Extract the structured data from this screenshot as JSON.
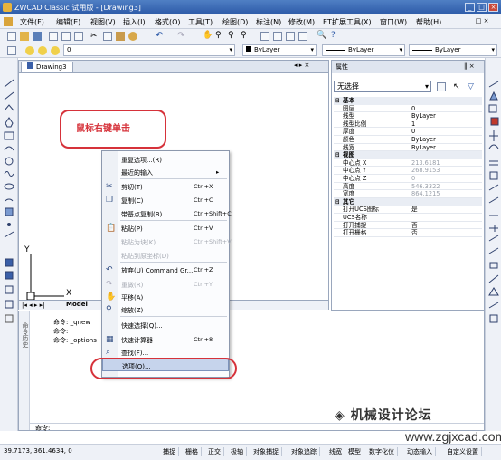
{
  "titlebar": {
    "title": "ZWCAD Classic 试用版 - [Drawing3]"
  },
  "menu": [
    "文件(F)",
    "编辑(E)",
    "视图(V)",
    "插入(I)",
    "格式(O)",
    "工具(T)",
    "绘图(D)",
    "标注(N)",
    "修改(M)",
    "ET扩展工具(X)",
    "窗口(W)",
    "帮助(H)"
  ],
  "toolbar2": {
    "layer": "0",
    "color": "ByLayer",
    "linetype": "ByLayer",
    "lineweight": "ByLayer"
  },
  "drawing": {
    "tab": "Drawing3",
    "model_tab": "Model",
    "axis_x": "X",
    "axis_y": "Y"
  },
  "properties": {
    "title": "属性",
    "selection": "无选择",
    "rows": [
      {
        "k": "基本",
        "v": "",
        "sec": true
      },
      {
        "k": "图层",
        "v": "0"
      },
      {
        "k": "线型",
        "v": "ByLayer"
      },
      {
        "k": "线型比例",
        "v": "1"
      },
      {
        "k": "厚度",
        "v": "0"
      },
      {
        "k": "颜色",
        "v": "ByLayer"
      },
      {
        "k": "线宽",
        "v": "ByLayer"
      },
      {
        "k": "视图",
        "v": "",
        "sec": true
      },
      {
        "k": "中心点 X",
        "v": "213.6181",
        "dim": true
      },
      {
        "k": "中心点 Y",
        "v": "268.9153",
        "dim": true
      },
      {
        "k": "中心点 Z",
        "v": "0",
        "dim": true
      },
      {
        "k": "高度",
        "v": "546.3322",
        "dim": true
      },
      {
        "k": "宽度",
        "v": "864.1215",
        "dim": true
      },
      {
        "k": "其它",
        "v": "",
        "sec": true
      },
      {
        "k": "打开UCS图标",
        "v": "是"
      },
      {
        "k": "UCS名称",
        "v": ""
      },
      {
        "k": "打开捕捉",
        "v": "否"
      },
      {
        "k": "打开栅格",
        "v": "否"
      }
    ]
  },
  "command": {
    "lines": [
      "命令:  _qnew",
      "命令:",
      "命令:  _options"
    ],
    "prompt": "命令:",
    "side_label": "命令历史"
  },
  "context_menu": {
    "items": [
      {
        "label": "重复选项...(R)",
        "shortcut": "",
        "submenu": false
      },
      {
        "label": "最近的输入",
        "shortcut": "▸",
        "submenu": true
      },
      {
        "label": "剪切(T)",
        "shortcut": "Ctrl+X",
        "icon": "scissors-icon"
      },
      {
        "label": "复制(C)",
        "shortcut": "Ctrl+C",
        "icon": "copy-icon"
      },
      {
        "label": "带基点复制(B)",
        "shortcut": "Ctrl+Shift+C"
      },
      {
        "label": "粘贴(P)",
        "shortcut": "Ctrl+V",
        "icon": "paste-icon"
      },
      {
        "label": "粘贴为块(K)",
        "shortcut": "Ctrl+Shift+V",
        "disabled": true
      },
      {
        "label": "粘贴到原坐标(D)",
        "shortcut": "",
        "disabled": true
      },
      {
        "label": "放弃(U) Command Gr...",
        "shortcut": "Ctrl+Z",
        "icon": "undo-icon"
      },
      {
        "label": "重做(R)",
        "shortcut": "Ctrl+Y",
        "disabled": true,
        "icon": "redo-icon"
      },
      {
        "label": "平移(A)",
        "shortcut": "",
        "icon": "pan-hand-icon"
      },
      {
        "label": "缩放(Z)",
        "shortcut": "",
        "icon": "zoom-icon"
      },
      {
        "label": "快速选择(Q)...",
        "shortcut": ""
      },
      {
        "label": "快速计算器",
        "shortcut": "Ctrl+8",
        "icon": "calculator-icon"
      },
      {
        "label": "查找(F)...",
        "shortcut": "",
        "icon": "find-icon"
      },
      {
        "label": "选项(O)...",
        "shortcut": "",
        "highlighted": true
      }
    ]
  },
  "annotation": {
    "bubble": "鼠标右键单击"
  },
  "watermark": {
    "text": "机械设计论坛",
    "url": "www.zgjxcad.com"
  },
  "status": {
    "coords": "39.7173, 361.4634, 0",
    "buttons": [
      "捕捉",
      "栅格",
      "正交",
      "极轴",
      "对象捕捉",
      "对象追踪",
      "线宽",
      "模型",
      "数字化仪",
      "动态输入",
      "自定义设置"
    ]
  },
  "colors": {
    "accent": "#2d5aa8",
    "highlight": "#c6d4ec",
    "annotation": "#d6323a"
  }
}
